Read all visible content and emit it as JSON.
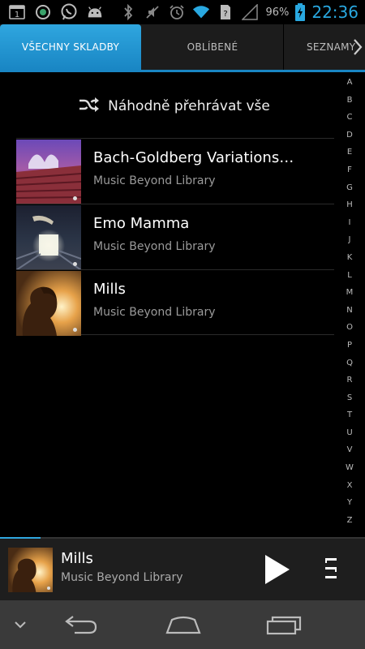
{
  "status_bar": {
    "notification_icons": [
      "screenshot-count-icon",
      "app-icon",
      "whatsapp-icon",
      "android-icon"
    ],
    "notification_badge": "1",
    "system_icons": [
      "bluetooth-icon",
      "mute-icon",
      "alarm-icon",
      "wifi-icon",
      "sim-icon",
      "signal-icon",
      "battery-charging-icon"
    ],
    "battery": "96%",
    "time": "22:36"
  },
  "tabs": [
    {
      "label": "VŠECHNY SKLADBY",
      "active": true
    },
    {
      "label": "OBLÍBENÉ",
      "active": false
    },
    {
      "label": "SEZNAMY",
      "active": false
    }
  ],
  "shuffle": {
    "label": "Náhodně přehrávat vše",
    "icon": "shuffle-icon"
  },
  "songs": [
    {
      "title": "Bach-Goldberg Variations…",
      "artist": "Music Beyond Library"
    },
    {
      "title": "Emo Mamma",
      "artist": "Music Beyond Library"
    },
    {
      "title": "Mills",
      "artist": "Music Beyond Library"
    }
  ],
  "alphabet": [
    "A",
    "B",
    "C",
    "D",
    "E",
    "F",
    "G",
    "H",
    "I",
    "J",
    "K",
    "L",
    "M",
    "N",
    "O",
    "P",
    "Q",
    "R",
    "S",
    "T",
    "U",
    "V",
    "W",
    "X",
    "Y",
    "Z"
  ],
  "now_playing": {
    "title": "Mills",
    "artist": "Music Beyond Library",
    "progress": 0.11
  },
  "nav": [
    "collapse-icon",
    "back-icon",
    "home-icon",
    "recents-icon"
  ],
  "colors": {
    "accent": "#1986c4",
    "clock": "#29a8e0",
    "background": "#000000"
  }
}
